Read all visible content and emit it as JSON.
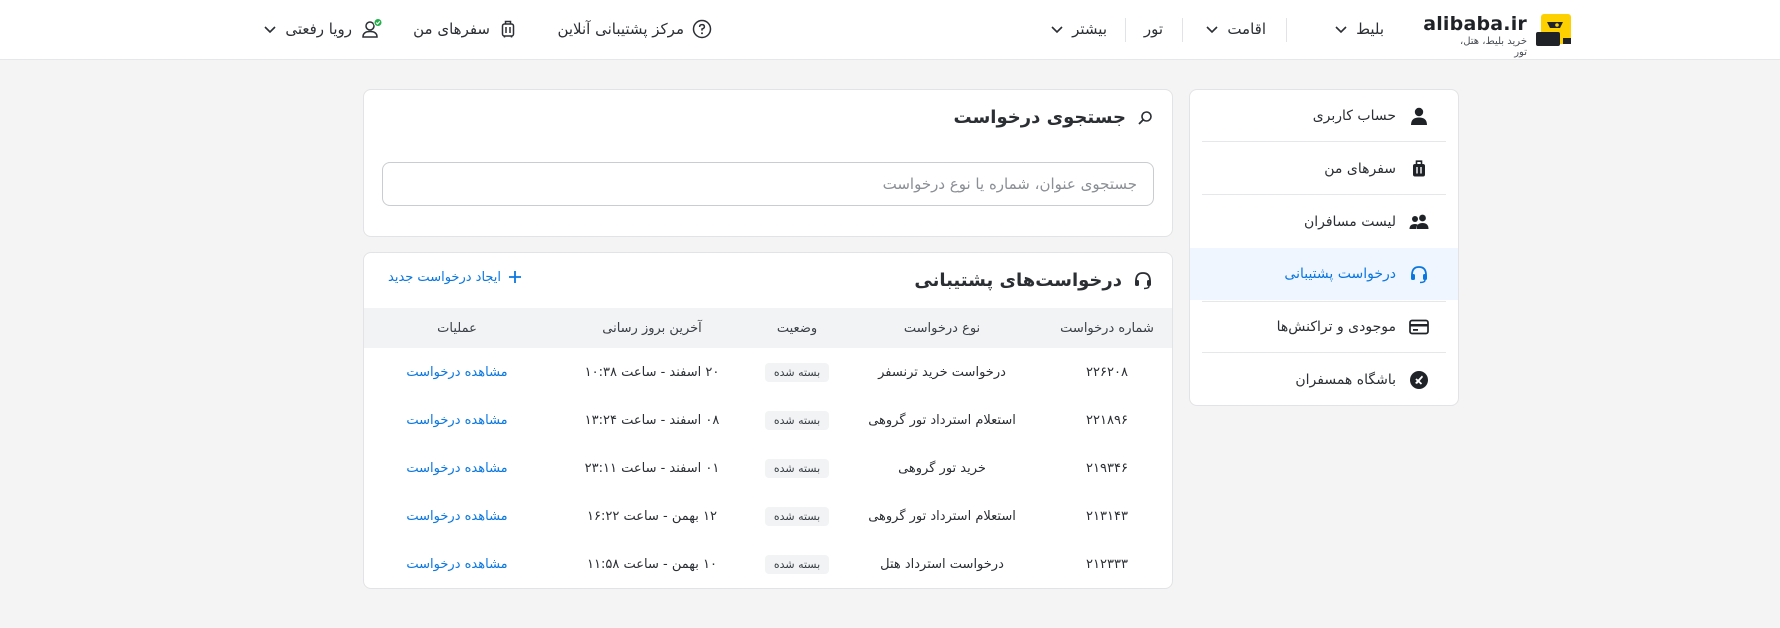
{
  "header": {
    "logo": {
      "name": "alibaba.ir",
      "tagline": "خرید بلیط، هتل، تور"
    },
    "nav": [
      {
        "label": "بلیط",
        "has_dropdown": true
      },
      {
        "label": "اقامت",
        "has_dropdown": true
      },
      {
        "label": "تور",
        "has_dropdown": false
      },
      {
        "label": "بیشتر",
        "has_dropdown": true
      }
    ],
    "support_center": "مرکز پشتیبانی آنلاین",
    "my_trips": "سفرهای من",
    "user_name": "رویا رفعتی"
  },
  "sidebar": {
    "items": [
      {
        "label": "حساب کاربری",
        "icon": "user-icon",
        "active": false
      },
      {
        "label": "سفرهای من",
        "icon": "luggage-icon",
        "active": false
      },
      {
        "label": "لیست مسافران",
        "icon": "passengers-icon",
        "active": false
      },
      {
        "label": "درخواست پشتیبانی",
        "icon": "headset-icon",
        "active": true
      },
      {
        "label": "موجودی و تراکنش‌ها",
        "icon": "card-icon",
        "active": false
      },
      {
        "label": "باشگاه همسفران",
        "icon": "club-icon",
        "active": false
      }
    ]
  },
  "search_section": {
    "title": "جستجوی درخواست",
    "placeholder": "جستجوی عنوان، شماره یا نوع درخواست"
  },
  "requests_section": {
    "title": "درخواست‌های پشتیبانی",
    "new_request": "ایجاد درخواست جدید",
    "columns": [
      "شماره درخواست",
      "نوع درخواست",
      "وضعیت",
      "آخرین بروز رسانی",
      "عملیات"
    ],
    "rows": [
      {
        "id": "۲۲۶۲۰۸",
        "type": "درخواست خرید ترنسفر",
        "status": "بسته شده",
        "updated": "۲۰ اسفند - ساعت ۱۰:۳۸",
        "action": "مشاهده درخواست"
      },
      {
        "id": "۲۲۱۸۹۶",
        "type": "استعلام استرداد تور گروهی",
        "status": "بسته شده",
        "updated": "۰۸ اسفند - ساعت ۱۳:۲۴",
        "action": "مشاهده درخواست"
      },
      {
        "id": "۲۱۹۳۴۶",
        "type": "خرید تور گروهی",
        "status": "بسته شده",
        "updated": "۰۱ اسفند - ساعت ۲۳:۱۱",
        "action": "مشاهده درخواست"
      },
      {
        "id": "۲۱۳۱۴۳",
        "type": "استعلام استرداد تور گروهی",
        "status": "بسته شده",
        "updated": "۱۲ بهمن - ساعت ۱۶:۲۲",
        "action": "مشاهده درخواست"
      },
      {
        "id": "۲۱۲۳۳۳",
        "type": "درخواست استرداد هتل",
        "status": "بسته شده",
        "updated": "۱۰ بهمن - ساعت ۱۱:۵۸",
        "action": "مشاهده درخواست"
      }
    ]
  },
  "colors": {
    "accent": "#0a77e0",
    "logo_yellow": "#fdd101",
    "online_dot": "#22b04b",
    "background": "#f4f4f5"
  }
}
